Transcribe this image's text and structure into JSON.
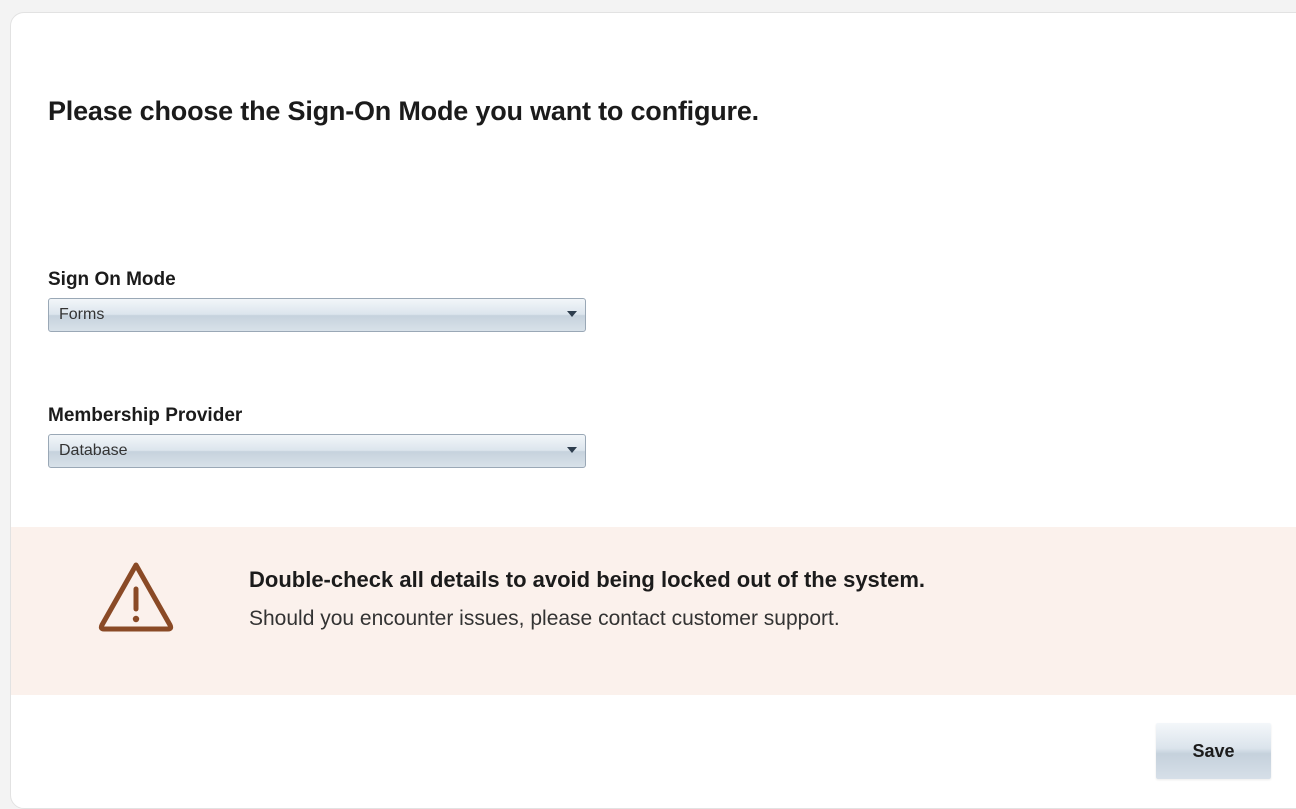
{
  "page": {
    "title": "Please choose the Sign-On Mode you want to configure."
  },
  "sign_on_mode": {
    "label": "Sign On Mode",
    "selected": "Forms"
  },
  "membership_provider": {
    "label": "Membership Provider",
    "selected": "Database"
  },
  "alert": {
    "icon": "warning-triangle-icon",
    "title": "Double-check all details to avoid being locked out of the system.",
    "text": "Should you encounter issues, please contact customer support.",
    "background_color": "#fbf1ec",
    "icon_color": "#8a4a26"
  },
  "actions": {
    "save_label": "Save"
  }
}
